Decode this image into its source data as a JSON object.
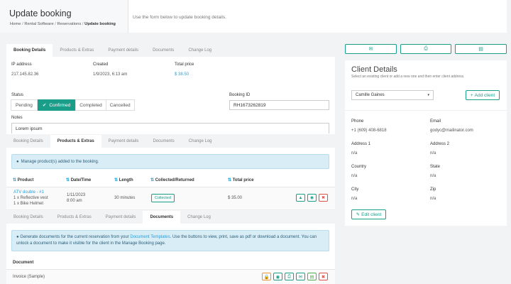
{
  "header": {
    "title": "Update booking",
    "breadcrumb": [
      "Home",
      "Rental Software",
      "Reservations",
      "Update booking"
    ],
    "description": "Use the form below to update booking details."
  },
  "tabs": [
    "Booking Details",
    "Products & Extras",
    "Payment details",
    "Documents",
    "Change Log"
  ],
  "booking": {
    "ip_label": "IP address",
    "ip_value": "217.145.82.36",
    "created_label": "Created",
    "created_value": "1/9/2023, 6:13 am",
    "total_label": "Total price",
    "total_value": "$ 38.50",
    "status_label": "Status",
    "statuses": [
      "Pending",
      "Confirmed",
      "Completed",
      "Cancelled"
    ],
    "selected_status": "Confirmed",
    "booking_id_label": "Booking ID",
    "booking_id_value": "RH1673262819",
    "notes_label": "Notes",
    "notes_value": "Lorem ipsum"
  },
  "products": {
    "alert": "Manage product(s) added to the booking.",
    "columns": [
      "Product",
      "Date/Time",
      "Length",
      "Collected/Returned",
      "Total price"
    ],
    "row": {
      "product": "ATV double - #1",
      "extras": [
        "1 x Reflective vest",
        "1 x Bike Helmet"
      ],
      "date": "1/11/2023",
      "time": "8:00 am",
      "length": "30 minutes",
      "collected": "Collected",
      "total": "$ 35.00"
    }
  },
  "documents": {
    "alert_pre": "Generate documents for the current reservation from your ",
    "alert_link": "Document Templates",
    "alert_post": ". Use the buttons to view, print, save as pdf or download a document. You can unlock a document to make it visible for the client in the Manage Booking page.",
    "column": "Document",
    "item": "Invoice (Sample)"
  },
  "client": {
    "title": "Client Details",
    "subtitle": "Select an existing client or add a new one and then enter client address.",
    "selected": "Camille Gaines",
    "add_label": "Add client",
    "fields": [
      {
        "label": "Phone",
        "value": "+1 (609) 408-6818"
      },
      {
        "label": "Email",
        "value": "godyc@mailinator.com"
      },
      {
        "label": "Address 1",
        "value": "n/a"
      },
      {
        "label": "Address 2",
        "value": "n/a"
      },
      {
        "label": "Country",
        "value": "n/a"
      },
      {
        "label": "State",
        "value": "n/a"
      },
      {
        "label": "City",
        "value": "n/a"
      },
      {
        "label": "Zip",
        "value": "n/a"
      }
    ],
    "edit_label": "Edit client"
  },
  "colors": {
    "accent": "#1a9e8a",
    "danger": "#d9534f",
    "info_bg": "#d8edf6",
    "link": "#2a9fd6"
  }
}
